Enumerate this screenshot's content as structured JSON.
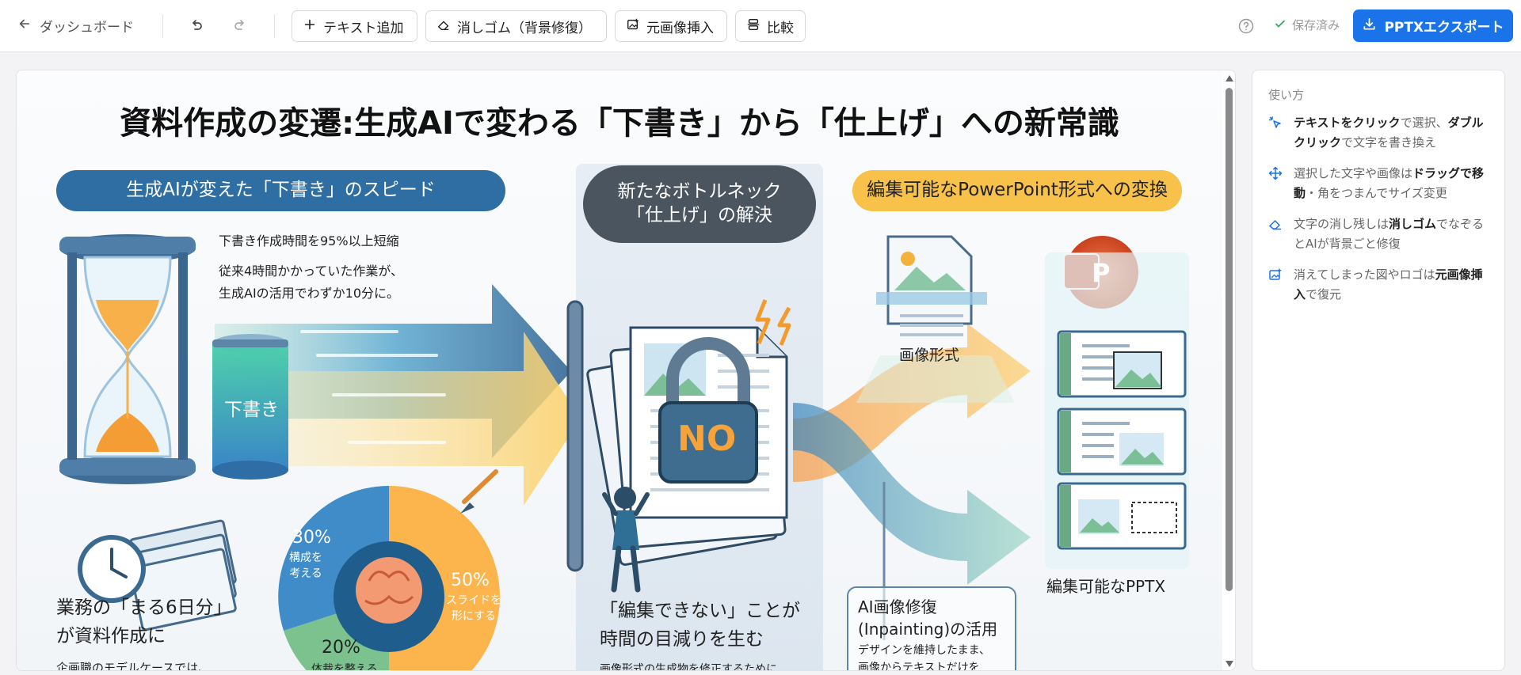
{
  "toolbar": {
    "back_label": "ダッシュボード",
    "add_text_label": "テキスト追加",
    "eraser_label": "消しゴム（背景修復）",
    "insert_image_label": "元画像挿入",
    "compare_label": "比較",
    "saved_label": "保存済み",
    "export_label": "PPTXエクスポート"
  },
  "colors": {
    "accent": "#1a73e8",
    "pill_blue": "#2e6ea3",
    "pill_dark": "#4a5560",
    "pill_yellow": "#f7c14a"
  },
  "slide": {
    "title": "資料作成の変遷:生成AIで変わる「下書き」から「仕上げ」への新常識",
    "left_header": "生成AIが変えた「下書き」のスピード",
    "mid_header": "新たなボトルネック\n「仕上げ」の解決",
    "right_header": "編集可能なPowerPoint形式への変換",
    "speed_line1": "下書き作成時間を95%以上短縮",
    "speed_line2": "従来4時間かかっていた作業が、",
    "speed_line3": "生成AIの活用でわずか10分に。",
    "tank_label": "下書き",
    "lock_label": "NO",
    "image_format_label": "画像形式",
    "editable_pptx_label": "編集可能なPPTX",
    "powerpoint_letter": "P",
    "pie_30_pct": "30%",
    "pie_30_label": "構成を\n考える",
    "pie_50_pct": "50%",
    "pie_50_label": "スライドを\n形にする",
    "pie_20_pct": "20%",
    "pie_20_label": "体裁を整える",
    "work_days_line1": "業務の「まる6日分」",
    "work_days_line2": "が資料作成に",
    "work_days_sub": "企画職のモデルケースでは、",
    "bottleneck_line1": "「編集できない」ことが",
    "bottleneck_line2": "時間の目減りを生む",
    "bottleneck_sub": "画像形式の生成物を修正するために",
    "inpaint_title1": "AI画像修復",
    "inpaint_title2": "(Inpainting)の活用",
    "inpaint_sub1": "デザインを維持したまま、",
    "inpaint_sub2": "画像からテキストだけを"
  },
  "help_panel": {
    "title": "使い方",
    "tips": [
      {
        "pre": "",
        "b1": "テキストをクリック",
        "mid": "で選択、",
        "b2": "ダブルクリック",
        "post": "で文字を書き換え"
      },
      {
        "pre": "選択した文字や画像は",
        "b1": "ドラッグで移動",
        "mid": "・角をつまんでサイズ変更",
        "b2": "",
        "post": ""
      },
      {
        "pre": "文字の消し残しは",
        "b1": "消しゴム",
        "mid": "でなぞるとAIが背景ごと修復",
        "b2": "",
        "post": ""
      },
      {
        "pre": "消えてしまった図やロゴは",
        "b1": "元画像挿入",
        "mid": "で復元",
        "b2": "",
        "post": ""
      }
    ]
  }
}
